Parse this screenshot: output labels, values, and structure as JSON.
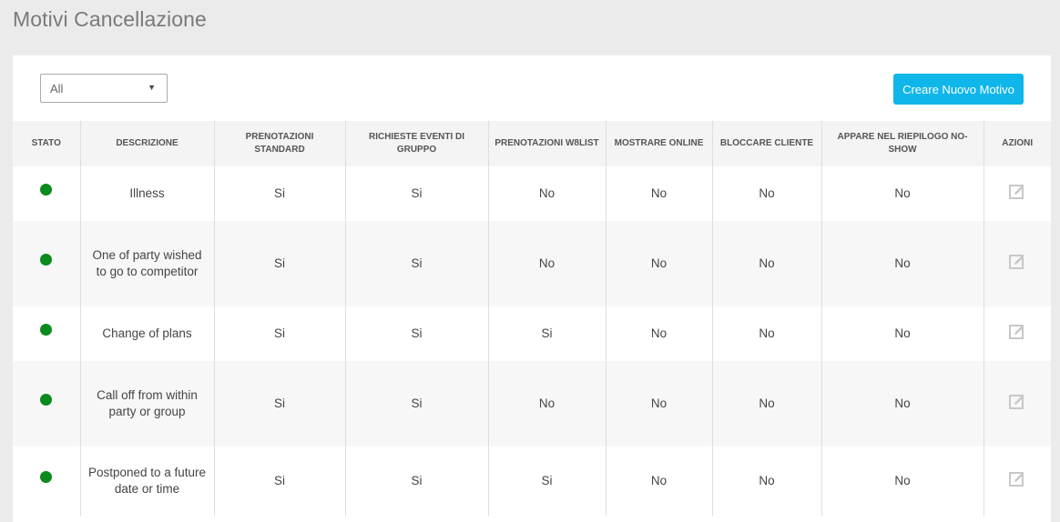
{
  "page": {
    "title": "Motivi Cancellazione"
  },
  "filter": {
    "value": "All"
  },
  "toolbar": {
    "create_label": "Creare Nuovo Motivo"
  },
  "table": {
    "headers": {
      "status": "STATO",
      "description": "DESCRIZIONE",
      "standard": "PRENOTAZIONI STANDARD",
      "group": "RICHIESTE EVENTI DI GRUPPO",
      "w8list": "PRENOTAZIONI W8LIST",
      "online": "MOSTRARE ONLINE",
      "block": "BLOCCARE CLIENTE",
      "noshow": "APPARE NEL RIEPILOGO NO-SHOW",
      "actions": "AZIONI"
    },
    "rows": [
      {
        "status": "active",
        "description": "Illness",
        "standard": "Si",
        "group": "Si",
        "w8list": "No",
        "online": "No",
        "block": "No",
        "noshow": "No"
      },
      {
        "status": "active",
        "description": "One of party wished to go to competitor",
        "standard": "Si",
        "group": "Si",
        "w8list": "No",
        "online": "No",
        "block": "No",
        "noshow": "No"
      },
      {
        "status": "active",
        "description": "Change of plans",
        "standard": "Si",
        "group": "Si",
        "w8list": "Si",
        "online": "No",
        "block": "No",
        "noshow": "No"
      },
      {
        "status": "active",
        "description": "Call off from within party or group",
        "standard": "Si",
        "group": "Si",
        "w8list": "No",
        "online": "No",
        "block": "No",
        "noshow": "No"
      },
      {
        "status": "active",
        "description": "Postponed to a future date or time",
        "standard": "Si",
        "group": "Si",
        "w8list": "Si",
        "online": "No",
        "block": "No",
        "noshow": "No"
      }
    ]
  },
  "icons": {
    "status": "status-dot-icon",
    "edit": "edit-icon",
    "select_caret": "caret-down-icon"
  },
  "colors": {
    "accent": "#0fb6ea",
    "status_active": "#0b8a1e",
    "icon_muted": "#c8c8c8"
  }
}
